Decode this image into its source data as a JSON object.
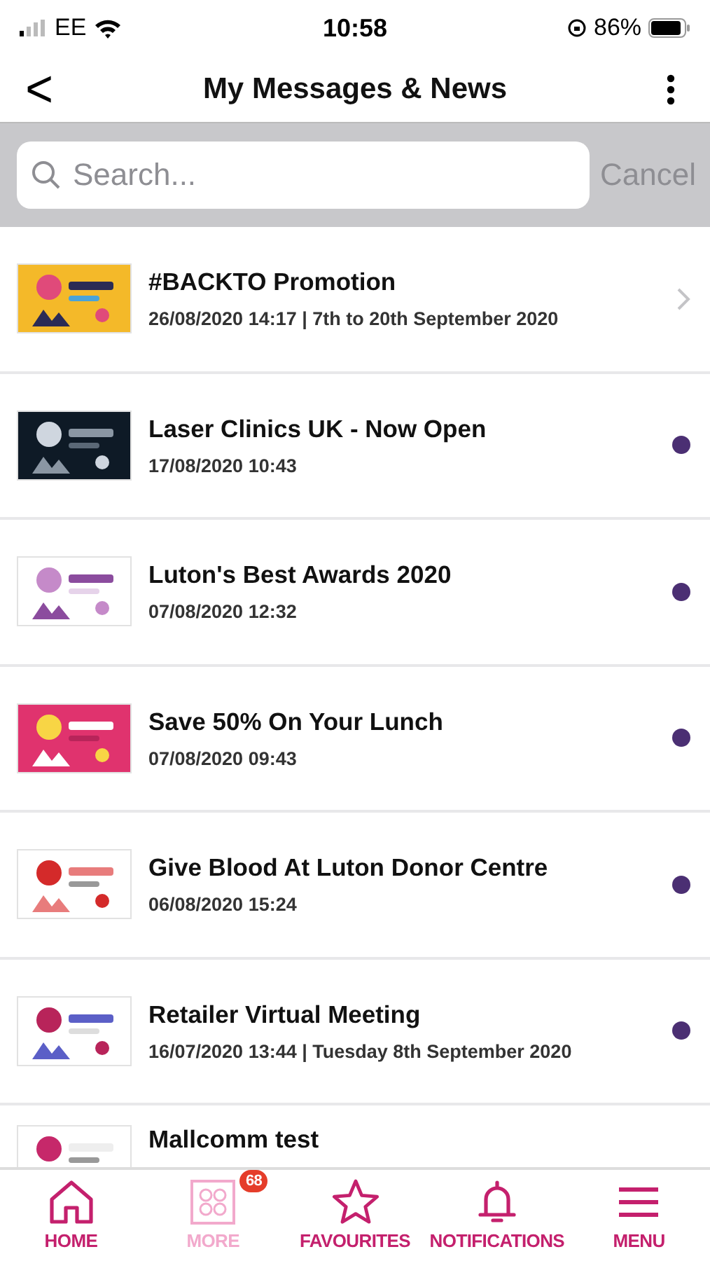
{
  "status_bar": {
    "carrier": "EE",
    "time": "10:58",
    "battery": "86%"
  },
  "nav": {
    "back": "<",
    "title": "My Messages & News"
  },
  "search": {
    "placeholder": "Search...",
    "cancel": "Cancel"
  },
  "messages": [
    {
      "title": "#BACKTO Promotion",
      "date": "26/08/2020 14:17 | 7th to 20th September 2020",
      "unread": false
    },
    {
      "title": "Laser Clinics UK - Now Open",
      "date": "17/08/2020 10:43",
      "unread": true
    },
    {
      "title": "Luton's Best Awards 2020",
      "date": "07/08/2020 12:32",
      "unread": true
    },
    {
      "title": "Save 50% On Your Lunch",
      "date": "07/08/2020 09:43",
      "unread": true
    },
    {
      "title": "Give Blood At Luton Donor Centre",
      "date": "06/08/2020 15:24",
      "unread": true
    },
    {
      "title": "Retailer Virtual Meeting",
      "date": "16/07/2020 13:44 | Tuesday 8th September 2020",
      "unread": true
    },
    {
      "title": "Mallcomm test"
    }
  ],
  "tab_bar": [
    {
      "label": "HOME",
      "selected": false
    },
    {
      "label": "MORE",
      "selected": true,
      "badge": "68"
    },
    {
      "label": "FAVOURITES",
      "selected": false
    },
    {
      "label": "NOTIFICATIONS",
      "selected": false
    },
    {
      "label": "MENU",
      "selected": false
    }
  ]
}
